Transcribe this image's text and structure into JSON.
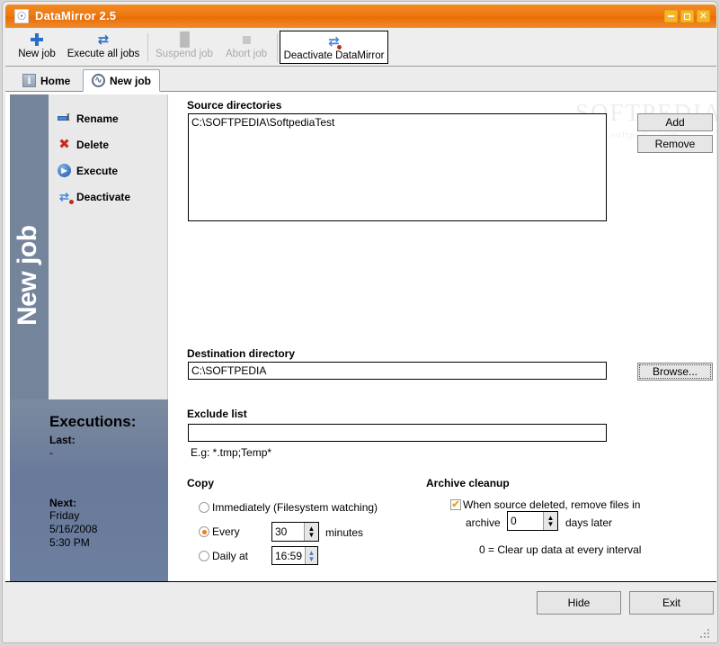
{
  "window": {
    "title": "DataMirror 2.5",
    "icon": "app-logo-icon",
    "minimize_label": "",
    "maximize_label": "",
    "close_label": "✕"
  },
  "toolbar": {
    "items": [
      {
        "label": "New job",
        "icon": "plus-icon",
        "enabled": true,
        "framed": false
      },
      {
        "label": "Execute all jobs",
        "icon": "refresh-arrows-icon",
        "enabled": true,
        "framed": false
      },
      {
        "label": "Suspend job",
        "icon": "pause-icon",
        "enabled": false,
        "framed": false
      },
      {
        "label": "Abort job",
        "icon": "stop-square-icon",
        "enabled": false,
        "framed": false
      },
      {
        "label": "Deactivate DataMirror",
        "icon": "deactivate-icon",
        "enabled": true,
        "framed": true
      }
    ]
  },
  "tabs": [
    {
      "label": "Home",
      "icon": "info-icon",
      "active": false
    },
    {
      "label": "New job",
      "icon": "circle-wave-icon",
      "active": true
    }
  ],
  "sidebar": {
    "vertical_title": "New job",
    "actions": [
      {
        "label": "Rename",
        "icon": "rename-icon"
      },
      {
        "label": "Delete",
        "icon": "delete-x-icon"
      },
      {
        "label": "Execute",
        "icon": "play-icon"
      },
      {
        "label": "Deactivate",
        "icon": "deactivate-icon"
      }
    ],
    "executions": {
      "title": "Executions:",
      "last_label": "Last:",
      "last_value": "-",
      "next_label": "Next:",
      "next_day": "Friday",
      "next_date": "5/16/2008",
      "next_time": "5:30 PM"
    }
  },
  "main": {
    "source": {
      "label": "Source directories",
      "entries": [
        "C:\\SOFTPEDIA\\SoftpediaTest"
      ],
      "add_label": "Add",
      "remove_label": "Remove"
    },
    "destination": {
      "label": "Destination directory",
      "value": "C:\\SOFTPEDIA",
      "placeholder": "",
      "browse_label": "Browse..."
    },
    "exclude": {
      "label": "Exclude list",
      "value": "",
      "placeholder": "",
      "hint": "E.g: *.tmp;Temp*"
    },
    "copy": {
      "label": "Copy",
      "options": [
        {
          "label": "Immediately (Filesystem watching)",
          "checked": false
        },
        {
          "label": "Every",
          "checked": true
        },
        {
          "label": "Daily at",
          "checked": false
        }
      ],
      "interval_value": "30",
      "interval_unit": "minutes",
      "daily_time": "16:59"
    },
    "archive": {
      "label": "Archive cleanup",
      "checkbox_checked": true,
      "checkbox_check_glyph": "✔",
      "text_line1": "When source deleted, remove files in",
      "text_line2_pre": "archive",
      "days_value": "0",
      "text_line2_post": "days later",
      "note": "0 = Clear up data at every interval"
    },
    "watermark": {
      "main": "SOFTPEDIA",
      "sub": "www.softpedia.com",
      "tm": "™"
    }
  },
  "footer": {
    "hide_label": "Hide",
    "exit_label": "Exit"
  }
}
